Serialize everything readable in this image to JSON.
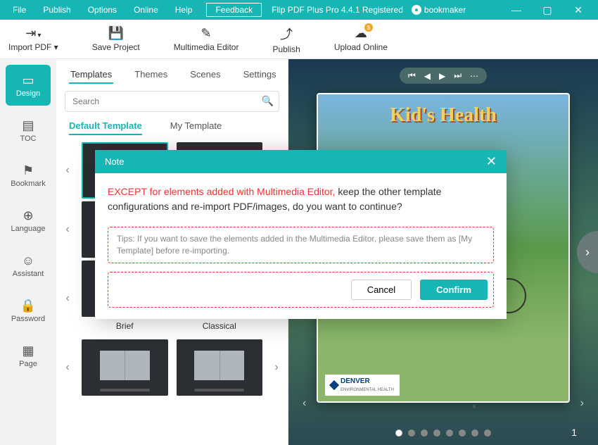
{
  "menubar": {
    "items": [
      "File",
      "Publish",
      "Options",
      "Online",
      "Help"
    ],
    "feedback": "Feedback",
    "app_title": "Flip PDF Plus Pro 4.4.1 Registered",
    "user": "bookmaker"
  },
  "toolbar": {
    "import_pdf": "Import PDF",
    "save_project": "Save Project",
    "multimedia_editor": "Multimedia Editor",
    "publish": "Publish",
    "upload_online": "Upload Online"
  },
  "left_nav": {
    "items": [
      {
        "label": "Design",
        "icon": "▭"
      },
      {
        "label": "TOC",
        "icon": "▤"
      },
      {
        "label": "Bookmark",
        "icon": "⚑"
      },
      {
        "label": "Language",
        "icon": "⊕"
      },
      {
        "label": "Assistant",
        "icon": "☺"
      },
      {
        "label": "Password",
        "icon": "🔒"
      },
      {
        "label": "Page",
        "icon": "▦"
      }
    ],
    "active_index": 0
  },
  "mid_panel": {
    "tabs": [
      "Templates",
      "Themes",
      "Scenes",
      "Settings"
    ],
    "tabs_active": 0,
    "search_placeholder": "Search",
    "sub_tabs": [
      "Default Template",
      "My Template"
    ],
    "sub_tabs_active": 0,
    "templates": [
      {
        "name": "Brief"
      },
      {
        "name": "Classical"
      }
    ]
  },
  "preview": {
    "book_title": "Kid's Health",
    "denver_label": "DENVER",
    "denver_sub": "ENVIRONMENTAL HEALTH",
    "page_number": "1",
    "dot_count": 8,
    "dot_active": 0
  },
  "modal": {
    "title": "Note",
    "body_red": "EXCEPT for elements added with Multimedia Editor,",
    "body_rest": " keep the other template configurations and re-import PDF/images, do you want to continue?",
    "tips": "Tips: If you want to save the elements added in the Multimedia Editor, please save them as [My Template] before re-importing.",
    "cancel": "Cancel",
    "confirm": "Confirm"
  }
}
